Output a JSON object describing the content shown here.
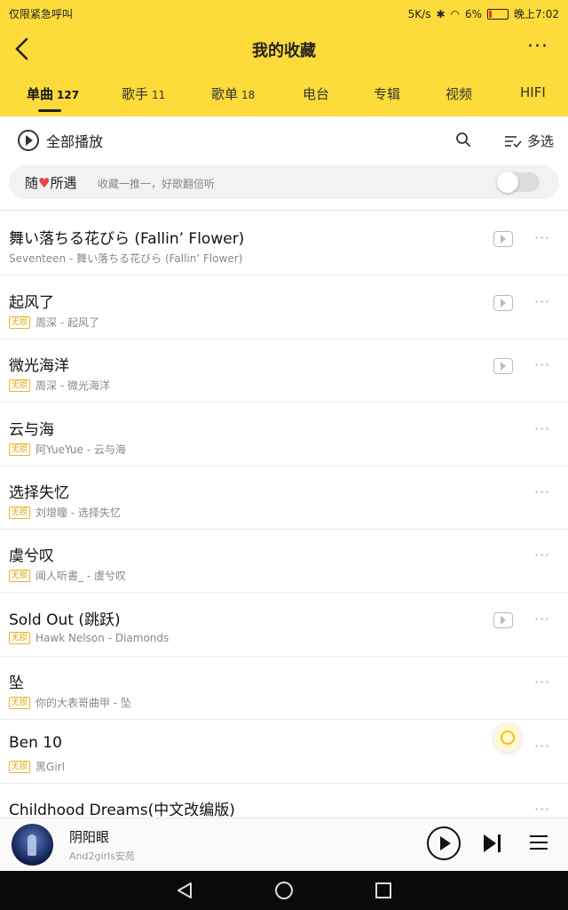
{
  "status": {
    "left": "仅限紧急呼叫",
    "speed": "5K/s",
    "battery": "6%",
    "time": "晚上7:02"
  },
  "header": {
    "title": "我的收藏"
  },
  "tabs": [
    {
      "label": "单曲",
      "count": "127"
    },
    {
      "label": "歌手",
      "count": "11"
    },
    {
      "label": "歌单",
      "count": "18"
    },
    {
      "label": "电台",
      "count": ""
    },
    {
      "label": "专辑",
      "count": ""
    },
    {
      "label": "视频",
      "count": ""
    },
    {
      "label": "HIFI",
      "count": ""
    }
  ],
  "toolbar": {
    "play_all": "全部播放",
    "multi_select": "多选"
  },
  "suiyu": {
    "label_prefix": "随",
    "label_suffix": "所遇",
    "desc": "收藏一推一，好歌翻倍听"
  },
  "badge": "无损",
  "songs": [
    {
      "title": "舞い落ちる花びら (Fallin’ Flower)",
      "subtitle": "Seventeen - 舞い落ちる花びら (Fallin’ Flower)"
    },
    {
      "title": "起风了",
      "subtitle": "周深 - 起风了"
    },
    {
      "title": "微光海洋",
      "subtitle": "周深 - 微光海洋"
    },
    {
      "title": "云与海",
      "subtitle": "阿YueYue - 云与海"
    },
    {
      "title": "选择失忆",
      "subtitle": "刘增瞳 - 选择失忆"
    },
    {
      "title": "虞兮叹",
      "subtitle": "闻人听書_ - 虞兮叹"
    },
    {
      "title": "Sold Out (跳跃)",
      "subtitle": "Hawk Nelson - Diamonds"
    },
    {
      "title": "坠",
      "subtitle": "你的大表哥曲甲 - 坠"
    },
    {
      "title": "Ben 10",
      "subtitle": "黑Girl"
    },
    {
      "title": "Childhood Dreams(中文改编版)",
      "subtitle": ""
    }
  ],
  "player": {
    "title": "阴阳眼",
    "artist": "And2girls安苑"
  },
  "colors": {
    "brand": "#fddb3a",
    "badge": "#e6b52a",
    "heart": "#e8413e"
  }
}
